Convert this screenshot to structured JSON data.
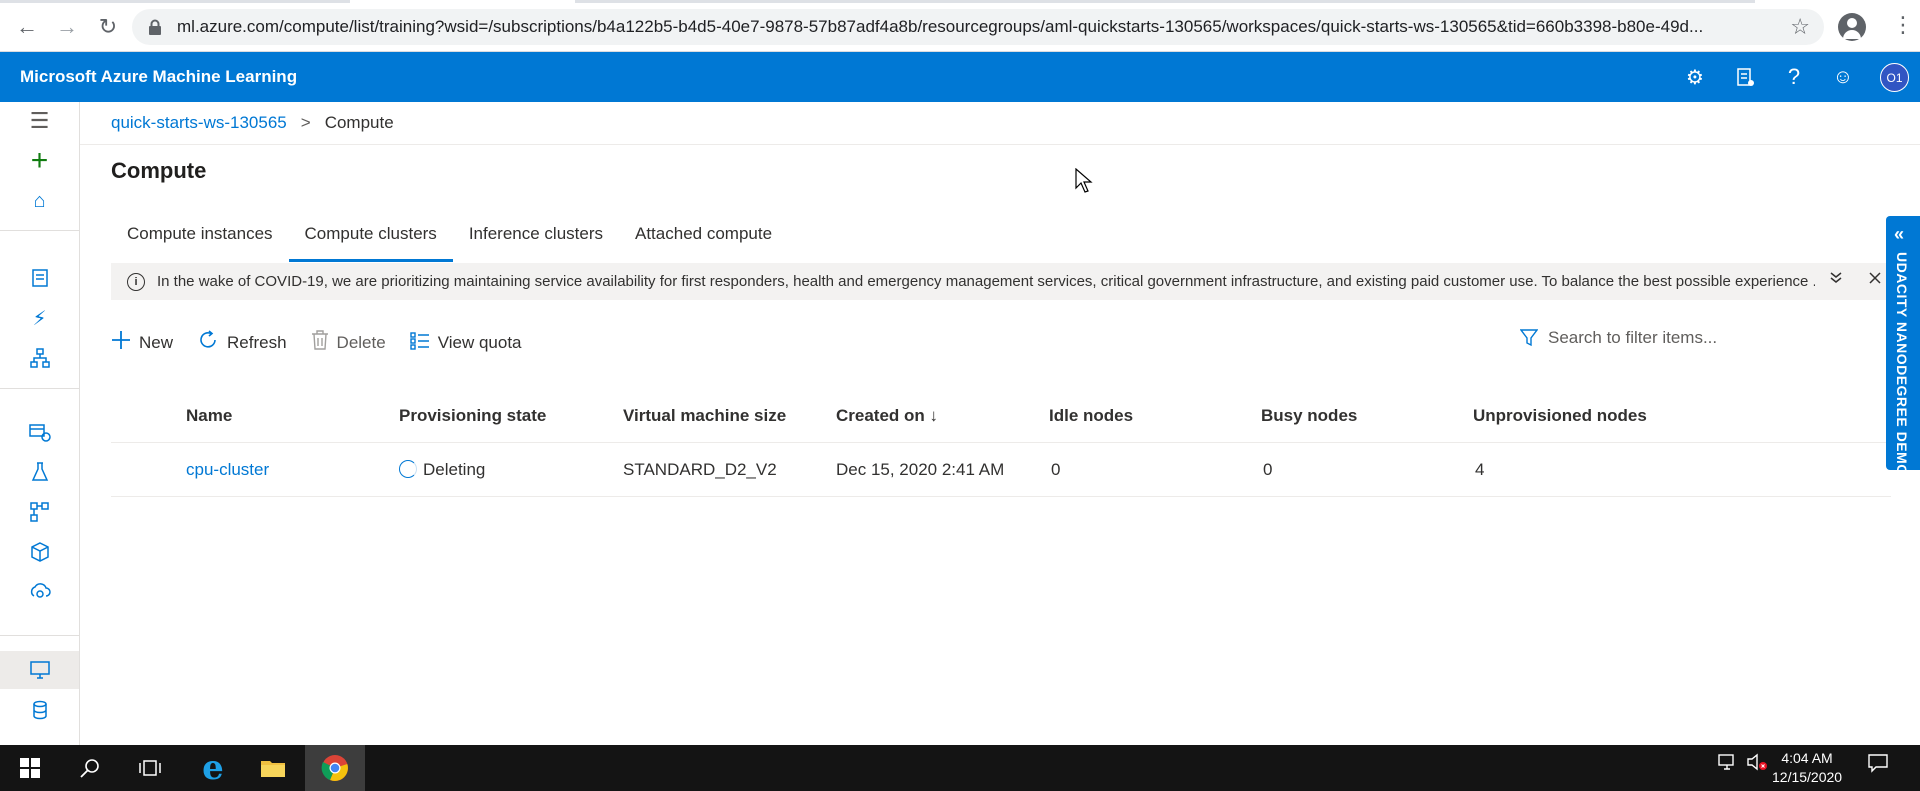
{
  "browser": {
    "url": "ml.azure.com/compute/list/training?wsid=/subscriptions/b4a122b5-b4d5-40e7-9878-57b87adf4a8b/resourcegroups/aml-quickstarts-130565/workspaces/quick-starts-ws-130565&tid=660b3398-b80e-49d..."
  },
  "header": {
    "title": "Microsoft Azure Machine Learning",
    "avatar_initials": "O1"
  },
  "breadcrumb": {
    "workspace": "quick-starts-ws-130565",
    "separator": ">",
    "current": "Compute"
  },
  "page": {
    "title": "Compute",
    "tabs": [
      {
        "label": "Compute instances"
      },
      {
        "label": "Compute clusters"
      },
      {
        "label": "Inference clusters"
      },
      {
        "label": "Attached compute"
      }
    ]
  },
  "banner": {
    "info_glyph": "i",
    "text": "In the wake of COVID-19, we are prioritizing maintaining service availability for first responders, health and emergency management services, critical government infrastructure, and existing paid customer use. To balance the best possible experience ..."
  },
  "commands": {
    "new": "New",
    "refresh": "Refresh",
    "delete": "Delete",
    "view_quota": "View quota",
    "search_placeholder": "Search to filter items..."
  },
  "table": {
    "columns": [
      "Name",
      "Provisioning state",
      "Virtual machine size",
      "Created on ↓",
      "Idle nodes",
      "Busy nodes",
      "Unprovisioned nodes"
    ],
    "rows": [
      {
        "name": "cpu-cluster",
        "state": "Deleting",
        "vm_size": "STANDARD_D2_V2",
        "created": "Dec 15, 2020 2:41 AM",
        "idle": "0",
        "busy": "0",
        "unprovisioned": "4"
      }
    ]
  },
  "side_tab": {
    "label": "UDACITY NANODEGREE DEMO"
  },
  "taskbar": {
    "time": "4:04 AM",
    "date": "12/15/2020"
  },
  "colors": {
    "accent": "#0078d4",
    "taskbar": "#141414",
    "banner": "#f3f2f1"
  }
}
